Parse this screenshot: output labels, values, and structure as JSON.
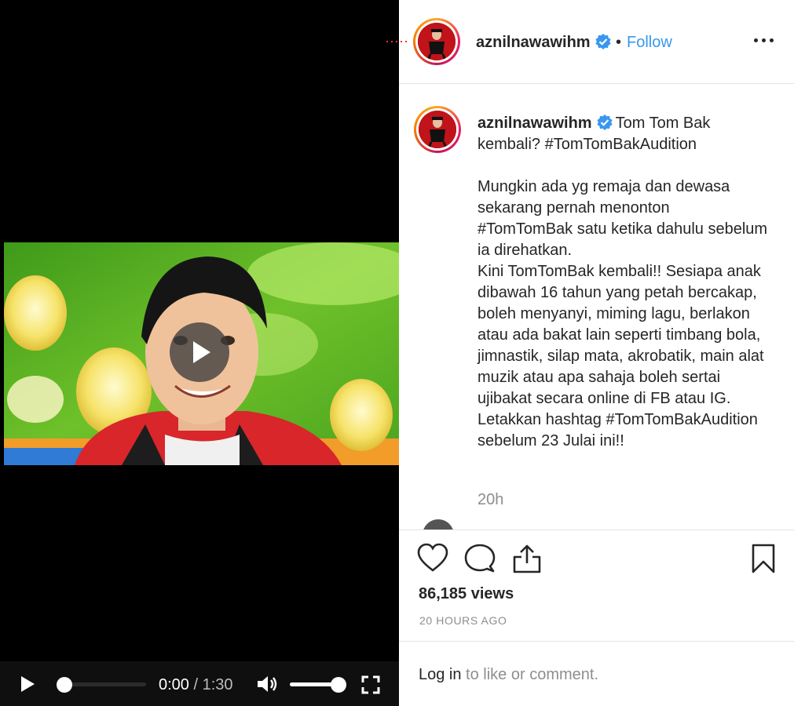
{
  "video": {
    "controls": {
      "current_time": "0:00",
      "separator": "/",
      "duration": "1:30",
      "progress_fraction": 0.0,
      "volume_fraction": 1.0
    }
  },
  "header": {
    "username": "aznilnawawihm",
    "verified": true,
    "bullet": "•",
    "follow_label": "Follow",
    "more_icon": "more-horizontal-icon"
  },
  "caption": {
    "username": "aznilnawawihm",
    "title": "Tom Tom Bak kembali? #TomTomBakAudition",
    "body": "Mungkin ada yg remaja dan dewasa sekarang pernah menonton #TomTomBak satu ketika dahulu sebelum ia direhatkan.\nKini TomTomBak kembali!! Sesiapa anak dibawah 16 tahun yang petah bercakap, boleh menyanyi, miming lagu, berlakon atau ada bakat lain seperti timbang bola, jimnastik, silap mata, akrobatik, main alat muzik atau apa sahaja boleh sertai ujibakat secara online di FB atau IG. Letakkan hashtag #TomTomBakAudition sebelum 23 Julai ini!!",
    "time_ago": "20h"
  },
  "actions": {
    "like_icon": "heart-icon",
    "comment_icon": "comment-icon",
    "share_icon": "share-icon",
    "save_icon": "bookmark-icon"
  },
  "stats": {
    "views": "86,185 views",
    "date": "20 HOURS AGO"
  },
  "login": {
    "link_label": "Log in",
    "rest": " to like or comment."
  },
  "colors": {
    "follow_blue": "#3897f0",
    "verified_blue": "#3897f0",
    "text_primary": "#262626",
    "text_secondary": "#8e8e8e"
  }
}
